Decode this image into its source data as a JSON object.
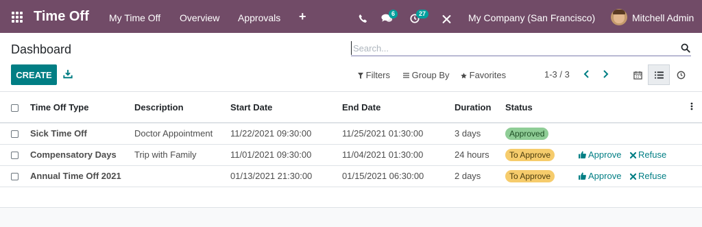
{
  "navbar": {
    "app_title": "Time Off",
    "menus": [
      "My Time Off",
      "Overview",
      "Approvals"
    ],
    "plus_label": "+",
    "messages_count": "6",
    "activities_count": "27",
    "company": "My Company (San Francisco)",
    "user": "Mitchell Admin",
    "bg_color": "#714B67"
  },
  "control_panel": {
    "breadcrumb": "Dashboard",
    "search_placeholder": "Search...",
    "create_label": "CREATE",
    "filters_label": "Filters",
    "groupby_label": "Group By",
    "favorites_label": "Favorites",
    "pager": "1-3 / 3",
    "accent_color": "#017E84"
  },
  "table": {
    "columns": [
      "Time Off Type",
      "Description",
      "Start Date",
      "End Date",
      "Duration",
      "Status"
    ],
    "rows": [
      {
        "type": "Sick Time Off",
        "description": "Doctor Appointment",
        "start": "11/22/2021 09:30:00",
        "end": "11/25/2021 01:30:00",
        "duration": "3 days",
        "status": "Approved",
        "approve": "",
        "refuse": ""
      },
      {
        "type": "Compensatory Days",
        "description": "Trip with Family",
        "start": "11/01/2021 09:30:00",
        "end": "11/04/2021 01:30:00",
        "duration": "24 hours",
        "status": "To Approve",
        "approve": "Approve",
        "refuse": "Refuse"
      },
      {
        "type": "Annual Time Off 2021",
        "description": "",
        "start": "01/13/2021 21:30:00",
        "end": "01/15/2021 06:30:00",
        "duration": "2 days",
        "status": "To Approve",
        "approve": "Approve",
        "refuse": "Refuse"
      }
    ]
  }
}
